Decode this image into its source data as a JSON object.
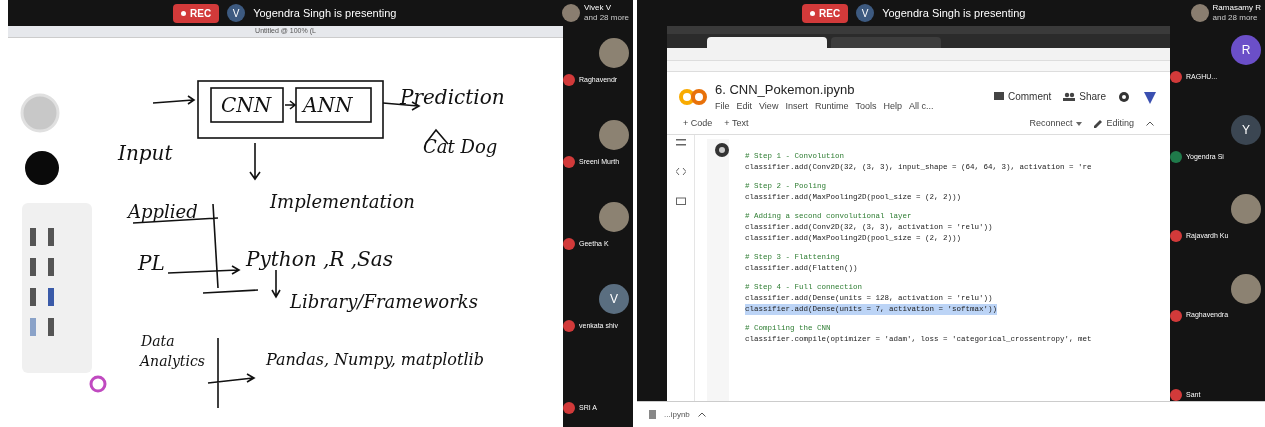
{
  "left_share": {
    "banner": {
      "rec": "REC",
      "avatar": "V",
      "text": "Yogendra Singh is presenting"
    },
    "top_tile": {
      "name": "Vivek V",
      "more": "and 28 more"
    },
    "app_title": "Untitled @ 100% (L",
    "whiteboard": {
      "notes": [
        {
          "text": "Input"
        },
        {
          "text": "CNN"
        },
        {
          "text": "ANN"
        },
        {
          "text": "Prediction"
        },
        {
          "text": "Cat Dog"
        },
        {
          "text": "Implementation"
        },
        {
          "text": "Applied"
        },
        {
          "text": "PL"
        },
        {
          "text": "Python ,R ,Sas"
        },
        {
          "text": "Library/Frameworks"
        },
        {
          "text": "Data"
        },
        {
          "text": "Analytics"
        },
        {
          "text": "Pandas, Numpy, matplotlib"
        }
      ]
    },
    "participants": [
      {
        "name": "Raghavendr",
        "kind": "photo",
        "muted": true
      },
      {
        "name": "Sreeni Murth",
        "kind": "photo",
        "muted": true
      },
      {
        "name": "Geetha K",
        "kind": "photo",
        "muted": true
      },
      {
        "name": "venkata shiv",
        "kind": "initial",
        "initial": "V",
        "muted": true
      },
      {
        "name": "SRI A",
        "kind": "plain",
        "muted": true
      }
    ]
  },
  "right_share": {
    "banner": {
      "rec": "REC",
      "avatar": "V",
      "text": "Yogendra Singh is presenting"
    },
    "top_tile": {
      "name": "Ramasamy R",
      "more": "and 28 more"
    },
    "notebook": {
      "title": "6. CNN_Pokemon.ipynb",
      "menu": [
        "File",
        "Edit",
        "View",
        "Insert",
        "Runtime",
        "Tools",
        "Help",
        "All c..."
      ],
      "header_buttons": [
        {
          "kind": "comment",
          "label": "Comment"
        },
        {
          "kind": "share",
          "label": "Share"
        }
      ],
      "toolbar": {
        "add": [
          "+ Code",
          "+ Text"
        ],
        "reconnect": "Reconnect",
        "editing": "Editing"
      },
      "blocks": [
        [
          {
            "kind": "comment",
            "text": "# Step 1 - Convolution",
            "selected": false
          },
          {
            "kind": "code",
            "text": "classifier.add(Conv2D(32, (3, 3), input_shape = (64, 64, 3), activation = 're",
            "selected": false
          }
        ],
        [
          {
            "kind": "comment",
            "text": "# Step 2 - Pooling",
            "selected": false
          },
          {
            "kind": "code",
            "text": "classifier.add(MaxPooling2D(pool_size = (2, 2)))",
            "selected": false
          }
        ],
        [
          {
            "kind": "comment",
            "text": "# Adding a second convolutional layer",
            "selected": false
          },
          {
            "kind": "code",
            "text": "classifier.add(Conv2D(32, (3, 3), activation = 'relu'))",
            "selected": false
          },
          {
            "kind": "code",
            "text": "classifier.add(MaxPooling2D(pool_size = (2, 2)))",
            "selected": false
          }
        ],
        [
          {
            "kind": "comment",
            "text": "# Step 3 - Flattening",
            "selected": false
          },
          {
            "kind": "code",
            "text": "classifier.add(Flatten())",
            "selected": false
          }
        ],
        [
          {
            "kind": "comment",
            "text": "# Step 4 - Full connection",
            "selected": false
          },
          {
            "kind": "code",
            "text": "classifier.add(Dense(units = 128, activation = 'relu'))",
            "selected": false
          },
          {
            "kind": "code",
            "text": "classifier.add(Dense(units = 7, activation = 'softmax'))",
            "selected": true
          }
        ],
        [
          {
            "kind": "comment",
            "text": "# Compiling the CNN",
            "selected": false
          },
          {
            "kind": "code",
            "text": "classifier.compile(optimizer = 'adam', loss = 'categorical_crossentropy', met",
            "selected": false
          }
        ]
      ]
    },
    "participants": [
      {
        "name": "RAGHU...",
        "kind": "initial",
        "initial": "R",
        "color": "#6b4fc8",
        "muted": true
      },
      {
        "name": "Yogendra Si",
        "kind": "initial",
        "initial": "Y",
        "color": "#3b4652",
        "muted": false
      },
      {
        "name": "Rajavardh Ku",
        "kind": "photo",
        "muted": true
      },
      {
        "name": "Raghavendra",
        "kind": "photo",
        "muted": true
      },
      {
        "name": "Sant",
        "kind": "plain",
        "muted": true
      }
    ],
    "download": {
      "file": "...ipynb"
    }
  }
}
